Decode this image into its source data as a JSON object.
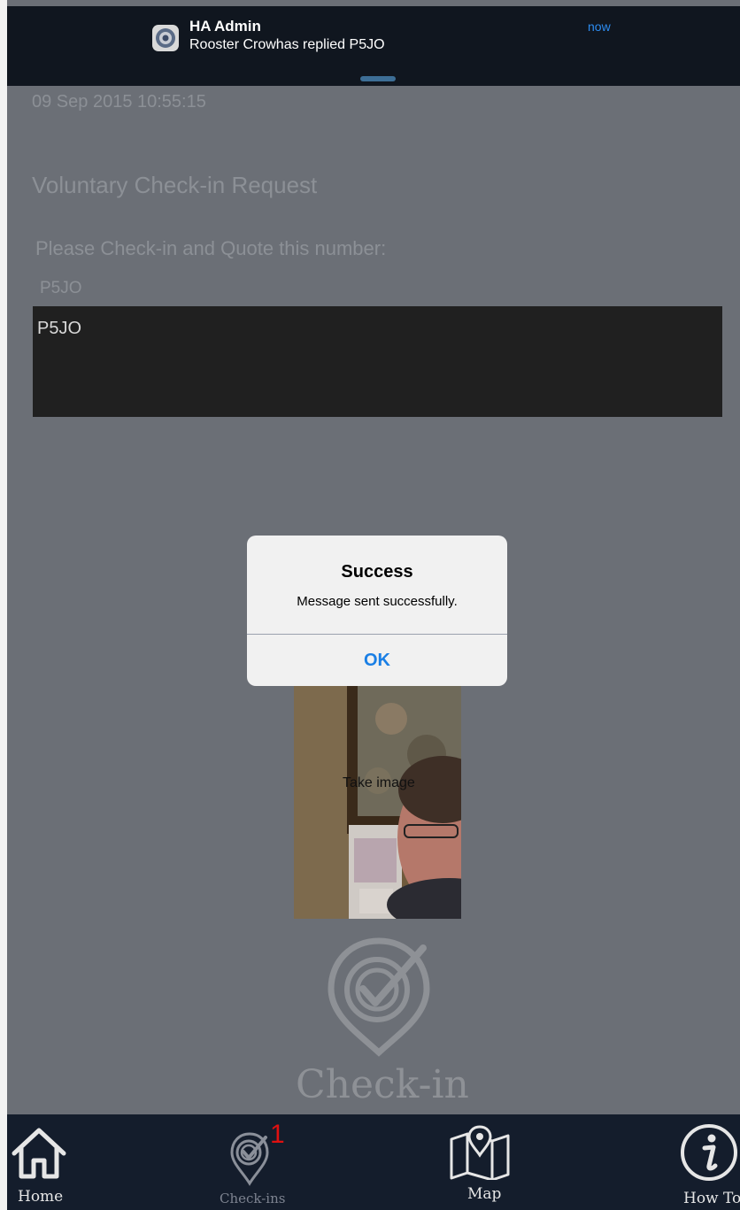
{
  "notification": {
    "app_name": "HA Admin",
    "message": "Rooster Crowhas replied P5JO",
    "time": "now"
  },
  "request": {
    "timestamp": "09 Sep 2015 10:55:15",
    "title": "Voluntary Check-in Request",
    "prompt": "Please Check-in and Quote this number:",
    "code": "P5JO",
    "reply_text": "P5JO"
  },
  "photo": {
    "caption": "Take image"
  },
  "brand": {
    "text": "Check-in"
  },
  "dialog": {
    "title": "Success",
    "message": "Message sent successfully.",
    "ok_label": "OK"
  },
  "tabs": [
    {
      "label": "Home",
      "icon": "home-icon"
    },
    {
      "label": "Check-ins",
      "icon": "checkin-target-icon",
      "badge": "1"
    },
    {
      "label": "Map",
      "icon": "map-icon"
    },
    {
      "label": "How To",
      "icon": "info-icon"
    }
  ],
  "colors": {
    "background": "#6b6f76",
    "banner": "#10161f",
    "tabbar": "#141d2c",
    "accent_blue": "#1a7fe5",
    "badge_red": "#e01010"
  }
}
